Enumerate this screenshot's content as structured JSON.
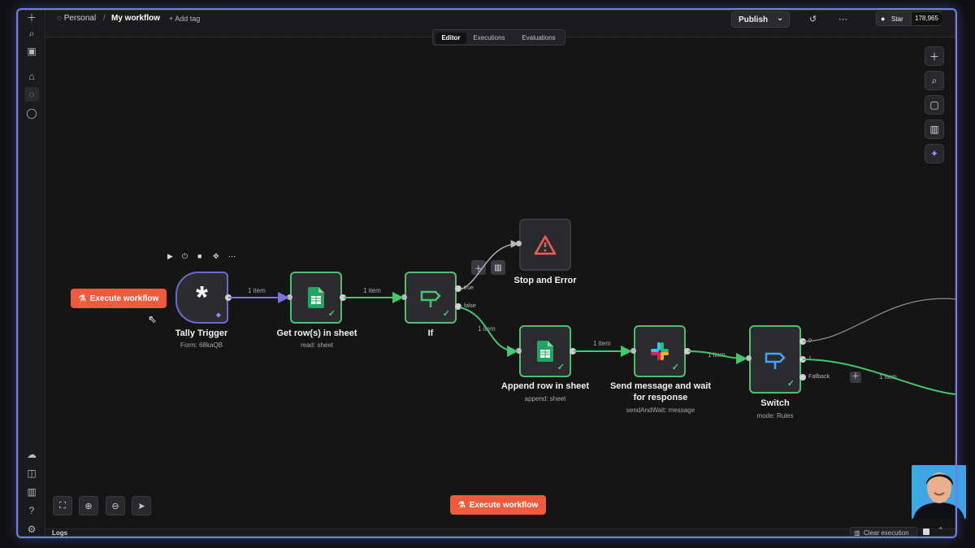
{
  "topbar": {
    "workspace": "Personal",
    "workflow_name": "My workflow",
    "add_tag": "+ Add tag",
    "publish": "Publish",
    "github_star": "Star",
    "github_count": "178,965"
  },
  "tabs": [
    "Editor",
    "Executions",
    "Evaluations"
  ],
  "nodes": {
    "tally": {
      "title": "Tally Trigger",
      "subtitle": "Form: 68kaQB"
    },
    "get_rows": {
      "title": "Get row(s) in sheet",
      "subtitle": "read: sheet"
    },
    "if": {
      "title": "If"
    },
    "stop_error": {
      "title": "Stop and Error"
    },
    "append_row": {
      "title": "Append row in sheet",
      "subtitle": "append: sheet"
    },
    "send_message": {
      "title": "Send message and wait",
      "title_line2": "for response",
      "subtitle": "sendAndWait: message"
    },
    "switch": {
      "title": "Switch",
      "subtitle": "mode: Rules"
    }
  },
  "connections": {
    "tally_to_get": "1 item",
    "get_to_if": "1 item",
    "if_to_append": "1 item",
    "append_to_send": "1 item",
    "send_to_switch": "1 item",
    "switch_out": "1 item"
  },
  "branch_labels": {
    "true": "true",
    "false": "false",
    "zero": "0",
    "one": "1",
    "fallback": "Fallback"
  },
  "buttons": {
    "execute_workflow": "Execute workflow",
    "execute_workflow_bottom": "Execute workflow",
    "clear_execution": "Clear execution"
  },
  "logs": {
    "label": "Logs"
  },
  "icons": {
    "left_rail": [
      "plus-icon",
      "search-icon",
      "sidebar-icon",
      "home-icon",
      "user-icon",
      "chat-icon",
      "cloud-icon",
      "package-icon",
      "chart-icon",
      "help-icon",
      "settings-icon"
    ],
    "right_tools": [
      "plus-icon",
      "search-icon",
      "note-icon",
      "panel-icon",
      "sparkle-icon"
    ],
    "bottom_tools": [
      "fit-view-icon",
      "zoom-in-icon",
      "zoom-out-icon",
      "cursor-tool-icon"
    ]
  },
  "colors": {
    "success": "#4fbf6f",
    "execute": "#ef5b3d",
    "trigger_border": "#6e6ad0",
    "frame_glow": "#6f7fe0"
  }
}
